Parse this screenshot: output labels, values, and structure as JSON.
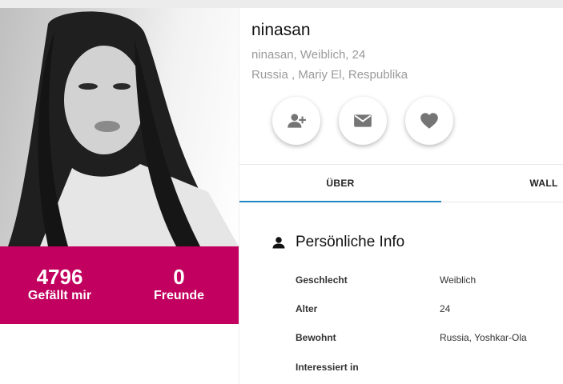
{
  "profile": {
    "username": "ninasan",
    "meta_line1": "ninasan, Weiblich, 24",
    "meta_line2": "Russia , Mariy El, Respublika"
  },
  "stats": {
    "likes_count": "4796",
    "likes_label": "Gefällt mir",
    "friends_count": "0",
    "friends_label": "Freunde"
  },
  "actions": {
    "icons": [
      "add-friend-icon",
      "mail-icon",
      "heart-icon"
    ]
  },
  "tabs": [
    {
      "label": "ÜBER",
      "active": true
    },
    {
      "label": "WALL",
      "active": false
    }
  ],
  "info": {
    "title": "Persönliche Info",
    "rows": [
      {
        "label": "Geschlecht",
        "value": "Weiblich"
      },
      {
        "label": "Alter",
        "value": "24"
      },
      {
        "label": "Bewohnt",
        "value": "Russia, Yoshkar-Ola"
      },
      {
        "label": "Interessiert in",
        "value": ""
      }
    ]
  },
  "colors": {
    "accent": "#c2005f",
    "tab_indicator": "#1e88c7"
  }
}
